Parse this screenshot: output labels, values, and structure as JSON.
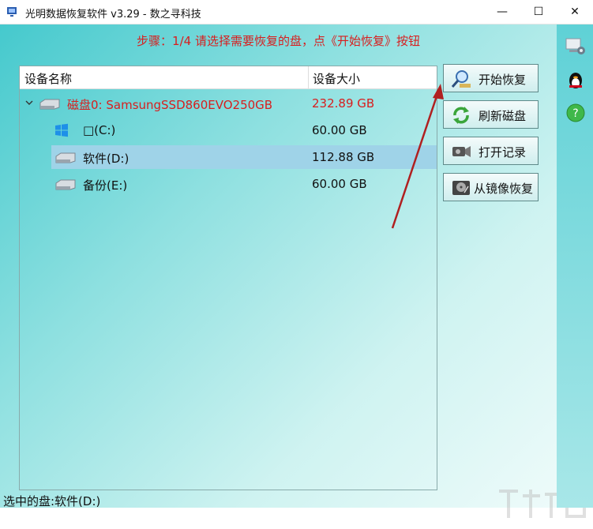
{
  "window": {
    "title": "光明数据恢复软件 v3.29 - 数之寻科技",
    "min_glyph": "—",
    "max_glyph": "☐",
    "close_glyph": "✕"
  },
  "step_label": "步骤：1/4 请选择需要恢复的盘，点《开始恢复》按钮",
  "device_list": {
    "headers": {
      "name": "设备名称",
      "size": "设备大小"
    },
    "rows": [
      {
        "name": "磁盘0: SamsungSSD860EVO250GB",
        "size": "232.89 GB",
        "icon": "disk-icon"
      },
      {
        "name": "□(C:)",
        "size": "60.00 GB",
        "icon": "windows-icon"
      },
      {
        "name": "软件(D:)",
        "size": "112.88 GB",
        "icon": "drive-icon"
      },
      {
        "name": "备份(E:)",
        "size": "60.00 GB",
        "icon": "drive-icon"
      }
    ]
  },
  "buttons": {
    "start": "开始恢复",
    "refresh": "刷新磁盘",
    "open_log": "打开记录",
    "from_image": "从镜像恢复"
  },
  "status": "选中的盘:软件(D:)",
  "colors": {
    "accent_red": "#d81e1e",
    "selection": "#9fd3e8",
    "teal": "#45c9cd"
  }
}
